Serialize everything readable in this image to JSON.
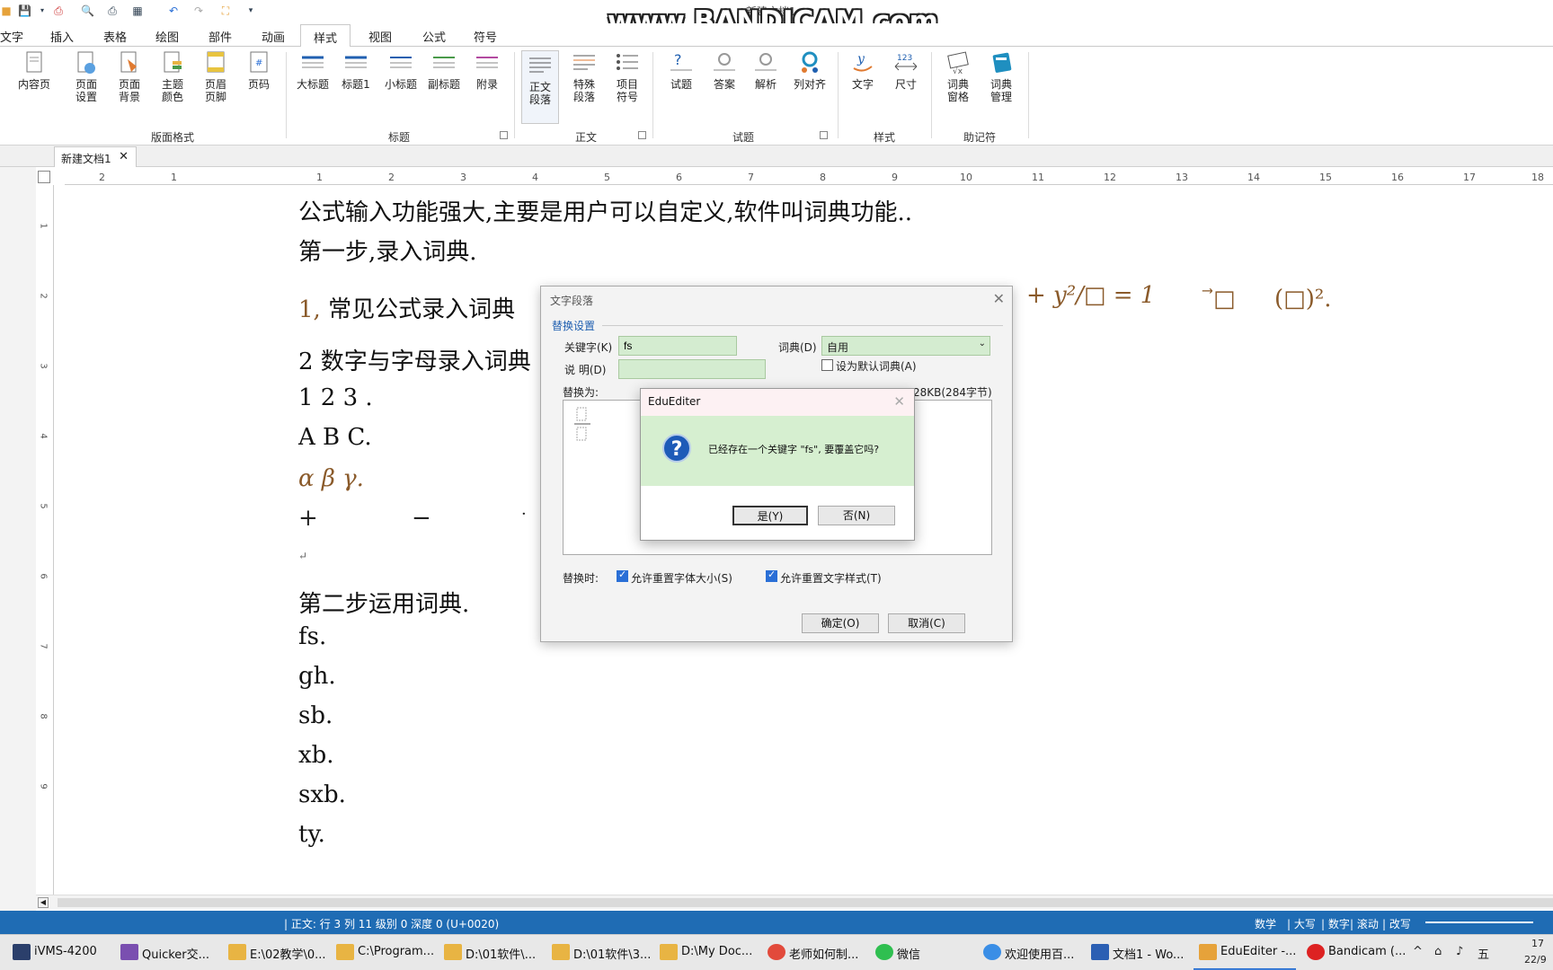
{
  "title_bar": {
    "watermark": "www.BANDICAM.com",
    "doc_title": "新建文档1"
  },
  "tabs": [
    "文字",
    "插入",
    "表格",
    "绘图",
    "部件",
    "动画",
    "样式",
    "视图",
    "公式",
    "符号"
  ],
  "active_tab": "样式",
  "ribbon": {
    "buttons": {
      "content_page": "内容页",
      "page_setup": "页面\n设置",
      "page_bg": "页面\n背景",
      "theme_color": "主题\n颜色",
      "header_footer": "页眉\n页脚",
      "page_number": "页码",
      "big_title": "大标题",
      "title1": "标题1",
      "small_title": "小标题",
      "subtitle": "副标题",
      "appendix": "附录",
      "body_para": "正文\n段落",
      "special_para": "特殊\n段落",
      "item_symbol": "项目\n符号",
      "question": "试题",
      "answer": "答案",
      "analysis": "解析",
      "column_align": "列对齐",
      "text": "文字",
      "size": "尺寸",
      "dict_window": "词典\n窗格",
      "dict_manage": "词典\n管理"
    },
    "groups": {
      "layout": "版面格式",
      "title": "标题",
      "body": "正文",
      "question": "试题",
      "style": "样式",
      "mnemonic": "助记符"
    }
  },
  "doc_tab": {
    "label": "新建文档1",
    "close": "✕"
  },
  "ruler": {
    "h_numbers": [
      "2",
      "1",
      "1",
      "2",
      "3",
      "4",
      "5",
      "6",
      "7",
      "8",
      "9",
      "10",
      "11",
      "12",
      "13",
      "14",
      "15",
      "16",
      "17",
      "18"
    ],
    "v_numbers": [
      "1",
      "2",
      "3",
      "4",
      "5",
      "6",
      "7",
      "8",
      "9"
    ]
  },
  "document": {
    "line1": "公式输入功能强大,主要是用户可以自定义,软件叫词典功能..",
    "line2": "第一步,录入词典.",
    "line3_num": "1,",
    "line3_text": "常见公式录入词典",
    "line4": "2 数字与字母录入词典",
    "line5": "1    2   3 .",
    "line6": "A B C.",
    "line7": "α   β   γ.",
    "line8_plus": "+",
    "line8_minus": "−",
    "line8_dot": "·",
    "line9": "↵",
    "line10": "第二步运用词典.",
    "items": [
      "fs.",
      "gh.",
      "sb.",
      "xb.",
      "sxb.",
      "ty."
    ],
    "formula_tail": "+ y²/□ = 1",
    "formula_paren": "(□)²."
  },
  "dialog": {
    "title": "文字段落",
    "close": "✕",
    "section": "替换设置",
    "keyword_label": "关键字(K)",
    "keyword_value": "fs",
    "desc_label": "说  明(D)",
    "desc_value": "",
    "dict_label": "词典(D)",
    "dict_value": "自用",
    "default_dict": "设为默认词典(A)",
    "replace_label": "替换为:",
    "size_info": "28KB(284字节)",
    "replace_when": "替换时:",
    "opt_font_size": "允许重置字体大小(S)",
    "opt_text_style": "允许重置文字样式(T)",
    "ok": "确定(O)",
    "cancel": "取消(C)"
  },
  "message_box": {
    "title": "EduEditer",
    "close": "✕",
    "text": "已经存在一个关键字 \"fs\", 要覆盖它吗?",
    "yes": "是(Y)",
    "no": "否(N)"
  },
  "status_bar": {
    "position": "| 正文:  行 3     列 11     级别 0     深度 0  (U+0020)",
    "right1": "数学",
    "right2": "| 大写",
    "right3": "| 数字",
    "right4": "| 滚动",
    "right5": "| 改写"
  },
  "taskbar": [
    {
      "label": "iVMS-4200",
      "color": "#2b3f6b"
    },
    {
      "label": "Quicker交...",
      "color": "#7a4fb0"
    },
    {
      "label": "E:\\02教学\\0...",
      "color": "#e8b443"
    },
    {
      "label": "C:\\Program...",
      "color": "#e8b443"
    },
    {
      "label": "D:\\01软件\\...",
      "color": "#e8b443"
    },
    {
      "label": "D:\\01软件\\3...",
      "color": "#e8b443"
    },
    {
      "label": "D:\\My Doc...",
      "color": "#e8b443"
    },
    {
      "label": "老师如何制...",
      "color": "#e24a3b"
    },
    {
      "label": "微信",
      "color": "#2fbf50"
    },
    {
      "label": "欢迎使用百...",
      "color": "#3a8ee6"
    },
    {
      "label": "文档1 - Wo...",
      "color": "#2b5fb3"
    },
    {
      "label": "EduEditer -...",
      "color": "#e6a23a"
    },
    {
      "label": "Bandicam (...",
      "color": "#d22"
    }
  ],
  "tray": {
    "ime": "五",
    "time": "17",
    "date": "22/9"
  }
}
